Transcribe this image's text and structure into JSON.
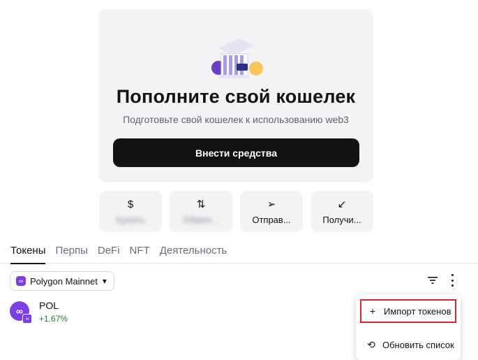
{
  "empty_state": {
    "title": "Пополните свой кошелек",
    "subtitle": "Подготовьте свой кошелек к использованию web3",
    "deposit_label": "Внести средства",
    "illustration": "bank-building-icon"
  },
  "actions": [
    {
      "icon": "dollar-icon",
      "glyph": "$",
      "label": "Купить",
      "blurred": true
    },
    {
      "icon": "swap-icon",
      "glyph": "⇅",
      "label": "Обмен...",
      "blurred": true
    },
    {
      "icon": "send-icon",
      "glyph": "➢",
      "label": "Отправ...",
      "blurred": false
    },
    {
      "icon": "receive-icon",
      "glyph": "↙",
      "label": "Получи...",
      "blurred": false
    }
  ],
  "tabs": [
    {
      "label": "Токены",
      "active": true
    },
    {
      "label": "Перпы",
      "active": false
    },
    {
      "label": "DeFi",
      "active": false
    },
    {
      "label": "NFT",
      "active": false
    },
    {
      "label": "Деятельность",
      "active": false
    }
  ],
  "network": {
    "label": "Polygon Mainnet",
    "icon": "polygon-icon"
  },
  "tokens": [
    {
      "name": "POL",
      "change": "+1.67%",
      "icon": "polygon-icon"
    }
  ],
  "menu": {
    "import_label": "Импорт токенов",
    "refresh_label": "Обновить список"
  },
  "colors": {
    "accent": "#121314",
    "polygon": "#7b3fe4",
    "positive": "#1c8234",
    "highlight_border": "#d7262e"
  }
}
